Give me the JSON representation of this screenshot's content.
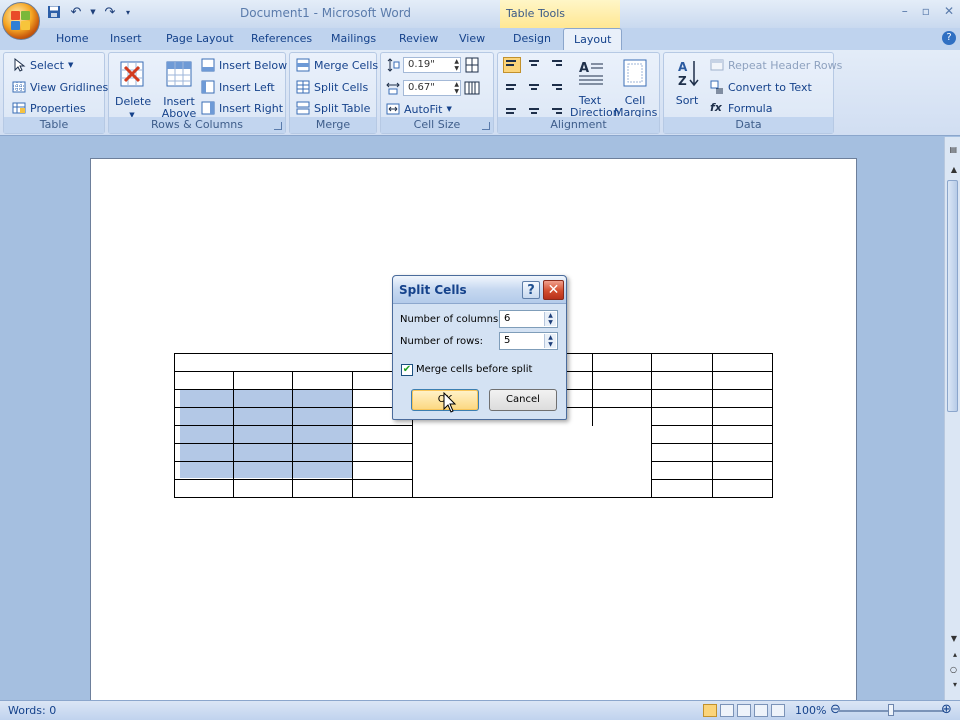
{
  "window": {
    "title": "Document1 - Microsoft Word",
    "contextual_group": "Table Tools"
  },
  "tabs": [
    "Home",
    "Insert",
    "Page Layout",
    "References",
    "Mailings",
    "Review",
    "View",
    "Design",
    "Layout"
  ],
  "active_tab": "Layout",
  "ribbon": {
    "table": {
      "label": "Table",
      "select": "Select",
      "view_gridlines": "View Gridlines",
      "properties": "Properties"
    },
    "rows_columns": {
      "label": "Rows & Columns",
      "delete": "Delete",
      "insert_above_1": "Insert",
      "insert_above_2": "Above",
      "insert_below": "Insert Below",
      "insert_left": "Insert Left",
      "insert_right": "Insert Right"
    },
    "merge": {
      "label": "Merge",
      "merge_cells": "Merge Cells",
      "split_cells": "Split Cells",
      "split_table": "Split Table"
    },
    "cell_size": {
      "label": "Cell Size",
      "height": "0.19\"",
      "width": "0.67\"",
      "autofit": "AutoFit"
    },
    "alignment": {
      "label": "Alignment",
      "text_direction_1": "Text",
      "text_direction_2": "Direction",
      "cell_margins_1": "Cell",
      "cell_margins_2": "Margins"
    },
    "data": {
      "label": "Data",
      "sort": "Sort",
      "repeat_header_rows": "Repeat Header Rows",
      "convert_to_text": "Convert to Text",
      "formula": "Formula"
    }
  },
  "dialog": {
    "title": "Split Cells",
    "columns_label": "Number of columns:",
    "columns_value": "6",
    "rows_label": "Number of rows:",
    "rows_value": "5",
    "merge_label": "Merge cells before split",
    "merge_checked": true,
    "ok": "OK",
    "cancel": "Cancel"
  },
  "status": {
    "words": "Words: 0",
    "zoom": "100%"
  },
  "colors": {
    "ribbon_text": "#15428b",
    "selection": "#b3c8e6",
    "contextual": "#ffe68f"
  }
}
